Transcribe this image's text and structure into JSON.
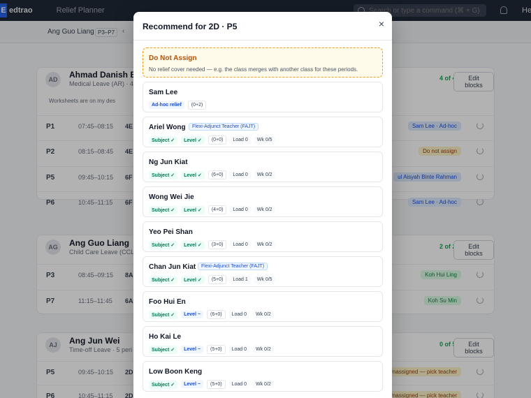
{
  "topbar": {
    "brand_mark": "E",
    "brand_name": "edtrao",
    "app_title": "Relief Planner",
    "search_placeholder": "Search or type a command (⌘ + G)",
    "user": "He"
  },
  "filter": {
    "name": "Ang Guo Liang",
    "range": "P3–P7",
    "chevron": "‹"
  },
  "background": {
    "worksheet_note": "Worksheets are on my des",
    "cards": [
      {
        "initials": "AD",
        "name": "Ahmad Danish Bin",
        "sub": "Medical Leave (AR) · 4",
        "covered": "4 of 4 covered",
        "edit": "Edit blocks"
      },
      {
        "initials": "AG",
        "name": "Ang Guo Liang",
        "sub": "Child Care Leave (CCL)",
        "covered": "2 of 2 covered",
        "edit": "Edit blocks"
      },
      {
        "initials": "AJ",
        "name": "Ang Jun Wei",
        "sub": "Time-off Leave · 5 peri",
        "covered": "0 of 5 covered",
        "edit": "Edit blocks"
      }
    ],
    "rows": [
      {
        "period": "P1",
        "time": "07:45–08:15",
        "cls": "4E",
        "assigned": "Sam Lee · Ad-hoc",
        "tone": "blue"
      },
      {
        "period": "P2",
        "time": "08:15–08:45",
        "cls": "4E",
        "assigned": "Do not assign",
        "tone": "amber"
      },
      {
        "period": "P5",
        "time": "09:45–10:15",
        "cls": "6F",
        "assigned": "ul Aisyah Binte Rahman",
        "tone": "blue"
      },
      {
        "period": "P6",
        "time": "10:45–11:15",
        "cls": "6F",
        "assigned": "Sam Lee · Ad-hoc",
        "tone": "blue"
      },
      {
        "period": "P3",
        "time": "08:45–09:15",
        "cls": "8A",
        "assigned": "Koh Hui Ling",
        "tone": "green"
      },
      {
        "period": "P7",
        "time": "11:15–11:45",
        "cls": "6A",
        "assigned": "Koh Su Min",
        "tone": "green"
      },
      {
        "period": "P5",
        "time": "09:45–10:15",
        "cls": "2D",
        "assigned": "Unassigned — pick teacher",
        "tone": "amber"
      },
      {
        "period": "P6",
        "time": "10:45–11:15",
        "cls": "2D",
        "assigned": "Unassigned — pick teacher",
        "tone": "amber"
      }
    ]
  },
  "modal": {
    "title": "Recommend for 2D · P5",
    "close": "×",
    "do_not_assign": {
      "title": "Do Not Assign",
      "desc": "No relief cover needed — e.g. the class merges with another class for these periods."
    },
    "teachers": [
      {
        "name": "Sam Lee",
        "tag": "",
        "chips": [
          "Ad-hoc relief",
          "(0+2)"
        ]
      },
      {
        "name": "Ariel Wong",
        "tag": "Flexi-Adjunct Teacher (FAJT)",
        "subject": "Subject ✓",
        "level": "Level ✓",
        "score": "(0+0)",
        "load": "Load 0",
        "wk": "Wk 0/5"
      },
      {
        "name": "Ng Jun Kiat",
        "tag": "",
        "subject": "Subject ✓",
        "level": "Level ✓",
        "score": "(6+0)",
        "load": "Load 0",
        "wk": "Wk 0/2"
      },
      {
        "name": "Wong Wei Jie",
        "tag": "",
        "subject": "Subject ✓",
        "level": "Level ✓",
        "score": "(4+0)",
        "load": "Load 0",
        "wk": "Wk 0/2"
      },
      {
        "name": "Yeo Pei Shan",
        "tag": "",
        "subject": "Subject ✓",
        "level": "Level ✓",
        "score": "(3+0)",
        "load": "Load 0",
        "wk": "Wk 0/2"
      },
      {
        "name": "Chan Jun Kiat",
        "tag": "Flexi-Adjunct Teacher (FAJT)",
        "subject": "Subject ✓",
        "level": "Level ✓",
        "score": "(5+0)",
        "load": "Load 1",
        "wk": "Wk 0/5"
      },
      {
        "name": "Foo Hui En",
        "tag": "",
        "subject": "Subject ✓",
        "level": "Level ~",
        "score": "(6+0)",
        "load": "Load 0",
        "wk": "Wk 0/2"
      },
      {
        "name": "Ho Kai Le",
        "tag": "",
        "subject": "Subject ✓",
        "level": "Level ~",
        "score": "(5+0)",
        "load": "Load 0",
        "wk": "Wk 0/2"
      },
      {
        "name": "Low Boon Keng",
        "tag": "",
        "subject": "Subject ✓",
        "level": "Level ~",
        "score": "(5+0)",
        "load": "Load 0",
        "wk": "Wk 0/2"
      }
    ]
  }
}
